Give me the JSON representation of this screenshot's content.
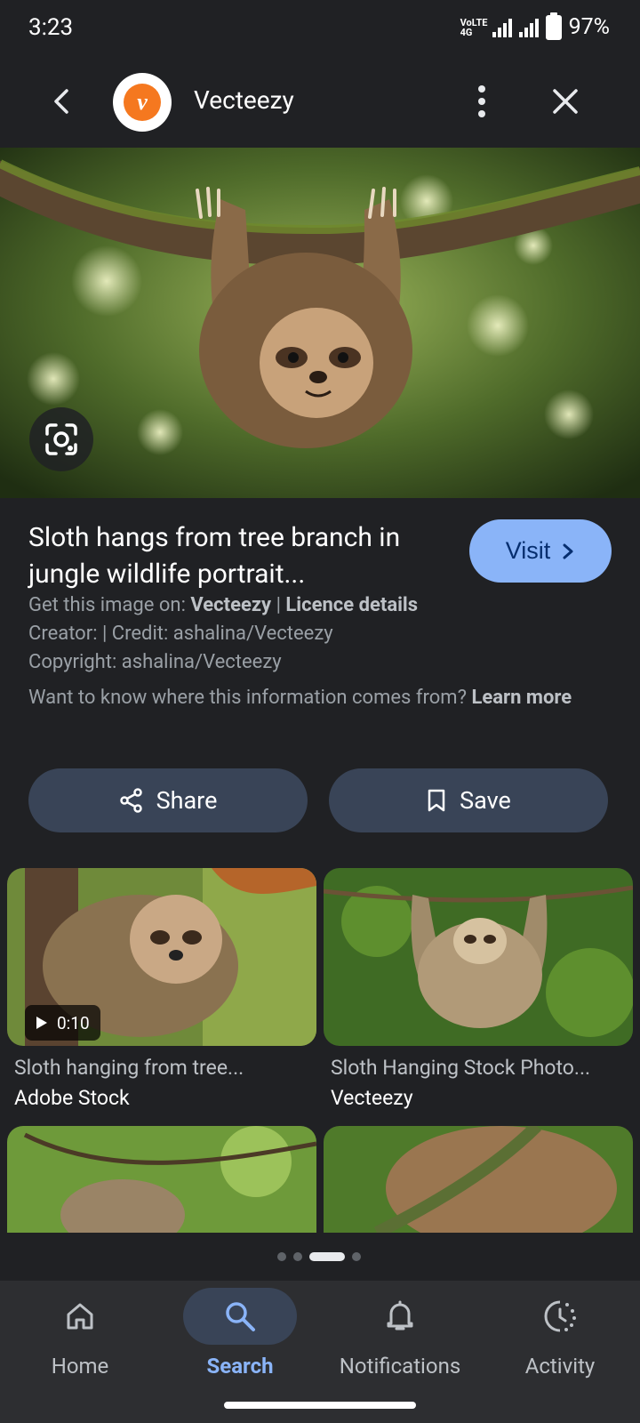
{
  "status": {
    "time": "3:23",
    "network": "VoLTE 4G",
    "battery": "97%"
  },
  "header": {
    "site_name": "Vecteezy",
    "logo_letter": "v"
  },
  "result": {
    "title": "Sloth hangs from tree branch in jungle wildlife portrait...",
    "visit_label": "Visit",
    "get_image_prefix": "Get this image on:",
    "get_image_site": "Vecteezy",
    "licence_label": "Licence details",
    "creator_line": "Creator: | Credit: ashalina/Vecteezy",
    "copyright_line": "Copyright: ashalina/Vecteezy",
    "info_question": "Want to know where this information comes from?",
    "learn_more": "Learn more"
  },
  "actions": {
    "share_label": "Share",
    "save_label": "Save"
  },
  "related": [
    {
      "caption": "Sloth hanging from tree...",
      "source": "Adobe Stock",
      "video_duration": "0:10"
    },
    {
      "caption": "Sloth Hanging Stock Photo...",
      "source": "Vecteezy"
    }
  ],
  "pager": {
    "active_index": 2,
    "count": 4
  },
  "nav": {
    "items": [
      {
        "label": "Home",
        "icon": "home-icon"
      },
      {
        "label": "Search",
        "icon": "search-icon"
      },
      {
        "label": "Notifications",
        "icon": "bell-icon"
      },
      {
        "label": "Activity",
        "icon": "activity-icon"
      }
    ],
    "active": "Search"
  },
  "colors": {
    "accent": "#8ab4f8",
    "background": "#202124",
    "pill": "#394457",
    "brand_orange": "#f5781f"
  }
}
